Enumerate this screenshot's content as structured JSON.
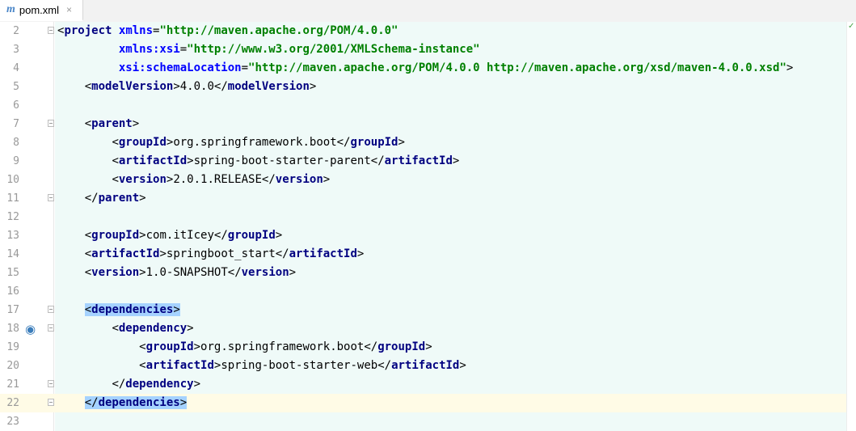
{
  "tab": {
    "title": "pom.xml",
    "icon": "m",
    "close": "×"
  },
  "status": {
    "check": "✓"
  },
  "lines": [
    {
      "no": "2",
      "fold": true,
      "text": "<project xmlns=\"http://maven.apache.org/POM/4.0.0\""
    },
    {
      "no": "3",
      "fold": false,
      "text": "         xmlns:xsi=\"http://www.w3.org/2001/XMLSchema-instance\""
    },
    {
      "no": "4",
      "fold": false,
      "text": "         xsi:schemaLocation=\"http://maven.apache.org/POM/4.0.0 http://maven.apache.org/xsd/maven-4.0.0.xsd\">"
    },
    {
      "no": "5",
      "fold": false,
      "text": "    <modelVersion>4.0.0</modelVersion>"
    },
    {
      "no": "6",
      "fold": false,
      "text": ""
    },
    {
      "no": "7",
      "fold": true,
      "text": "    <parent>"
    },
    {
      "no": "8",
      "fold": false,
      "text": "        <groupId>org.springframework.boot</groupId>"
    },
    {
      "no": "9",
      "fold": false,
      "text": "        <artifactId>spring-boot-starter-parent</artifactId>"
    },
    {
      "no": "10",
      "fold": false,
      "text": "        <version>2.0.1.RELEASE</version>"
    },
    {
      "no": "11",
      "fold": true,
      "text": "    </parent>"
    },
    {
      "no": "12",
      "fold": false,
      "text": ""
    },
    {
      "no": "13",
      "fold": false,
      "text": "    <groupId>com.itIcey</groupId>"
    },
    {
      "no": "14",
      "fold": false,
      "text": "    <artifactId>springboot_start</artifactId>"
    },
    {
      "no": "15",
      "fold": false,
      "text": "    <version>1.0-SNAPSHOT</version>"
    },
    {
      "no": "16",
      "fold": false,
      "text": ""
    },
    {
      "no": "17",
      "fold": true,
      "text": "    <dependencies>",
      "selected": true
    },
    {
      "no": "18",
      "fold": true,
      "text": "        <dependency>",
      "icon": true
    },
    {
      "no": "19",
      "fold": false,
      "text": "            <groupId>org.springframework.boot</groupId>"
    },
    {
      "no": "20",
      "fold": false,
      "text": "            <artifactId>spring-boot-starter-web</artifactId>"
    },
    {
      "no": "21",
      "fold": true,
      "text": "        </dependency>"
    },
    {
      "no": "22",
      "fold": true,
      "text": "    </dependencies>",
      "selected": true,
      "current": true
    },
    {
      "no": "23",
      "fold": false,
      "text": ""
    }
  ]
}
